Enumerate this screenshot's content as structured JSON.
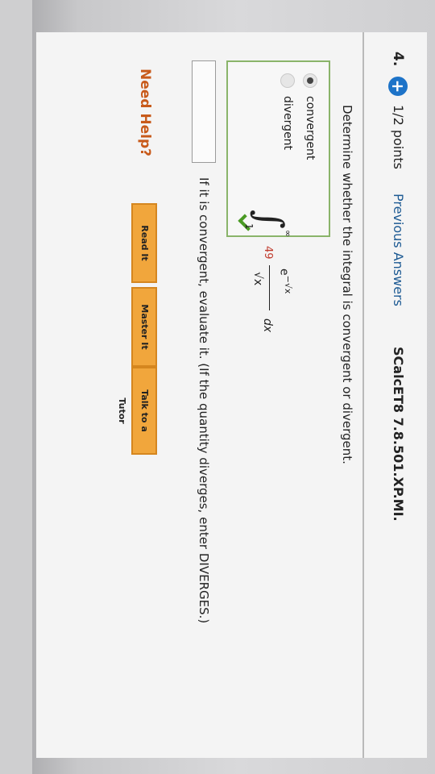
{
  "question": {
    "number": "4.",
    "points": "1/2 points",
    "previous_answers_label": "Previous Answers",
    "reference": "SCalcET8 7.8.501.XP.MI."
  },
  "prompt_1": "Determine whether the integral is convergent or divergent.",
  "integral": {
    "lower_limit": "1",
    "upper_limit": "∞",
    "coefficient": "49",
    "numerator_base": "e",
    "numerator_exponent": "−√x",
    "denominator": "√x",
    "differential": "dx"
  },
  "choices": [
    {
      "label": "convergent",
      "selected": true
    },
    {
      "label": "divergent",
      "selected": false
    }
  ],
  "correct_icon": "check-icon",
  "prompt_2": "If it is convergent, evaluate it. (If the quantity diverges, enter DIVERGES.)",
  "answer_value": "",
  "help": {
    "label": "Need Help?",
    "buttons": [
      "Read It",
      "Master It",
      "Talk to a Tutor"
    ]
  },
  "colors": {
    "accent": "#1d73c8",
    "help_button": "#f1a63c",
    "correct": "#4a9a24",
    "help_text": "#c85a1a"
  }
}
